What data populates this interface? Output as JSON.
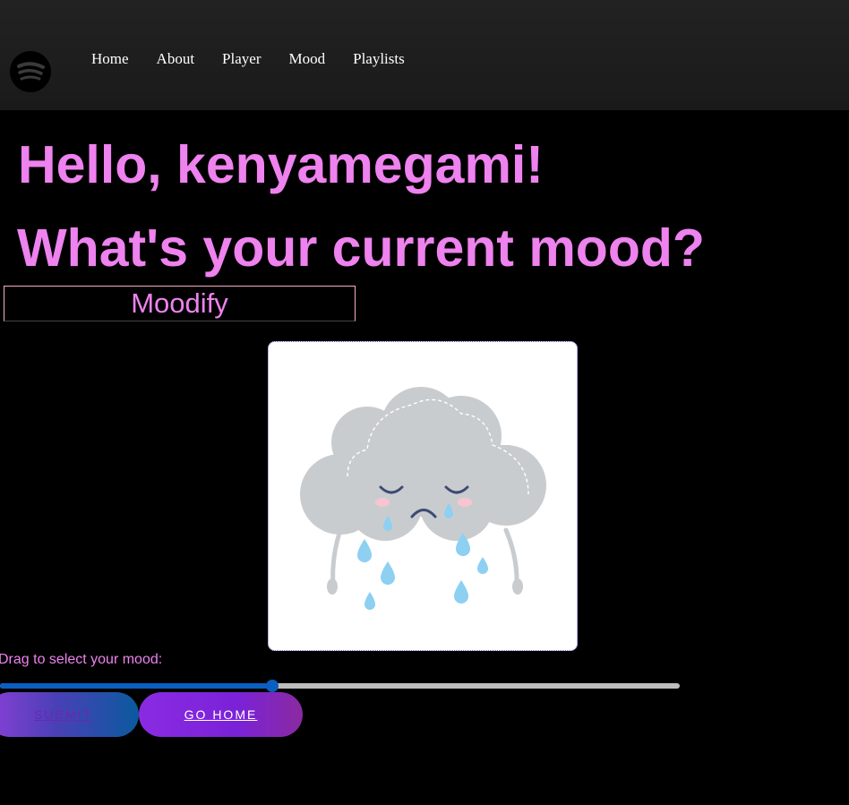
{
  "nav": {
    "logo_icon": "spotify-logo-icon",
    "links": [
      {
        "label": "Home"
      },
      {
        "label": "About"
      },
      {
        "label": "Player"
      },
      {
        "label": "Mood"
      },
      {
        "label": "Playlists"
      }
    ]
  },
  "main": {
    "greeting": "Hello, kenyamegami!",
    "question": "What's your current mood?",
    "brand": "Moodify",
    "mood_image_icon": "sad-rain-cloud-icon",
    "slider_label": "Drag to select your mood:",
    "slider_value_percent": 40,
    "submit_label": "SUBMIT",
    "home_label": "GO HOME"
  },
  "colors": {
    "accent": "#ee82ee",
    "slider": "#0a5fc0",
    "background": "#000000"
  }
}
